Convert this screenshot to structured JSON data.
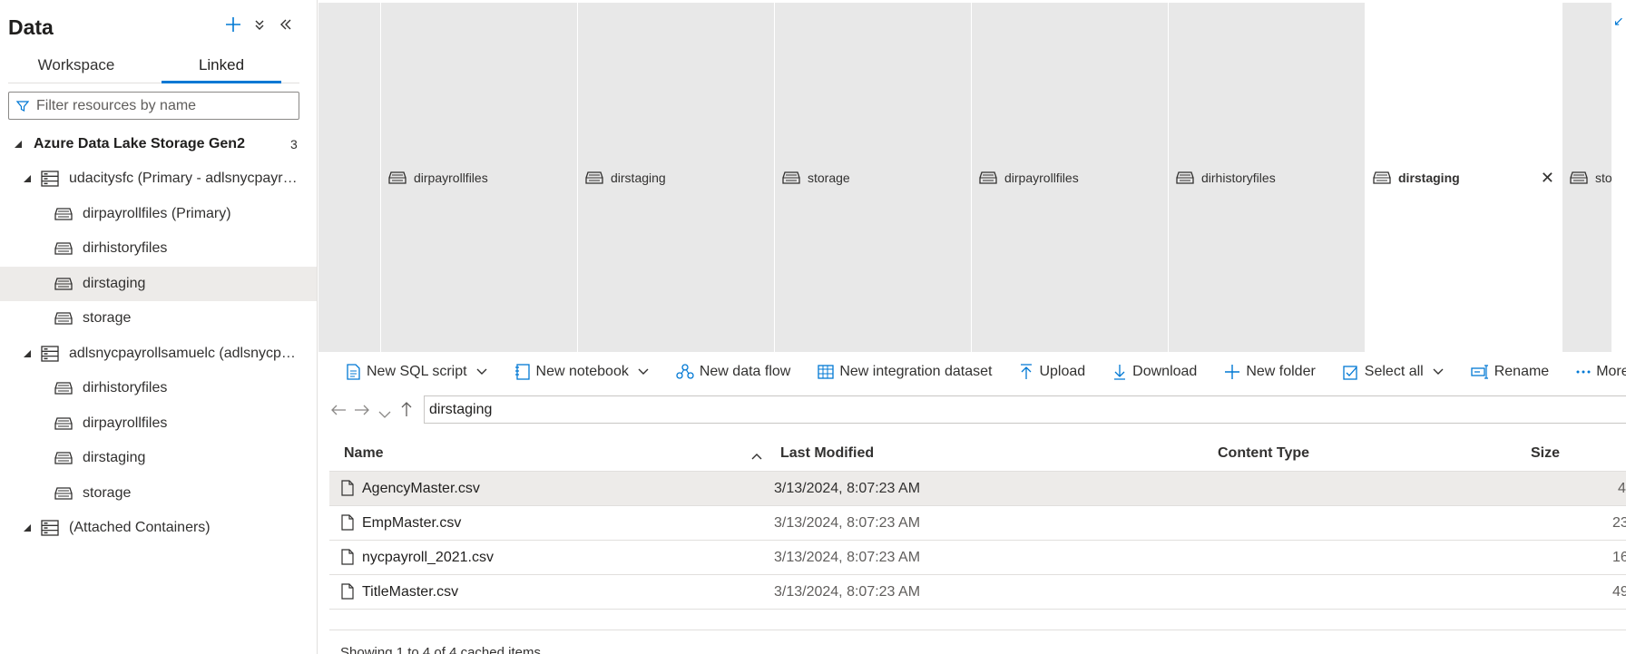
{
  "panel": {
    "title": "Data",
    "tabs": [
      {
        "label": "Workspace",
        "active": false
      },
      {
        "label": "Linked",
        "active": true
      }
    ],
    "filter_placeholder": "Filter resources by name",
    "tree": {
      "root_label": "Azure Data Lake Storage Gen2",
      "root_count": "3",
      "accounts": [
        {
          "label": "udacitysfc (Primary - adlsnycpayroll...",
          "containers": [
            "dirpayrollfiles (Primary)",
            "dirhistoryfiles",
            "dirstaging",
            "storage"
          ]
        },
        {
          "label": "adlsnycpayrollsamuelc (adlsnycpay...",
          "containers": [
            "dirhistoryfiles",
            "dirpayrollfiles",
            "dirstaging",
            "storage"
          ]
        },
        {
          "label": "(Attached Containers)",
          "containers": []
        }
      ],
      "selected": "dirstaging"
    }
  },
  "doc_tabs": [
    {
      "label": "dirpayrollfiles",
      "active": false
    },
    {
      "label": "dirstaging",
      "active": false
    },
    {
      "label": "storage",
      "active": false
    },
    {
      "label": "dirpayrollfiles",
      "active": false
    },
    {
      "label": "dirhistoryfiles",
      "active": false
    },
    {
      "label": "dirstaging",
      "active": true
    },
    {
      "label": "sto",
      "active": false
    }
  ],
  "toolbar": {
    "new_sql_script": "New SQL script",
    "new_notebook": "New notebook",
    "new_data_flow": "New data flow",
    "new_integration_dataset": "New integration dataset",
    "upload": "Upload",
    "download": "Download",
    "new_folder": "New folder",
    "select_all": "Select all",
    "rename": "Rename",
    "more": "More"
  },
  "address": {
    "path": "dirstaging"
  },
  "table": {
    "columns": [
      "Name",
      "Last Modified",
      "Content Type",
      "Size"
    ],
    "rows": [
      {
        "name": "AgencyMaster.csv",
        "modified": "3/13/2024, 8:07:23 AM",
        "content_type": "",
        "size": "4",
        "selected": true
      },
      {
        "name": "EmpMaster.csv",
        "modified": "3/13/2024, 8:07:23 AM",
        "content_type": "",
        "size": "23",
        "selected": false
      },
      {
        "name": "nycpayroll_2021.csv",
        "modified": "3/13/2024, 8:07:23 AM",
        "content_type": "",
        "size": "16",
        "selected": false
      },
      {
        "name": "TitleMaster.csv",
        "modified": "3/13/2024, 8:07:23 AM",
        "content_type": "",
        "size": "49",
        "selected": false
      }
    ],
    "footer": "Showing 1 to 4 of 4 cached items"
  },
  "colors": {
    "accent": "#0078d4",
    "selected_row": "#edebe9",
    "tabstrip_bg": "#e8e8e8"
  }
}
